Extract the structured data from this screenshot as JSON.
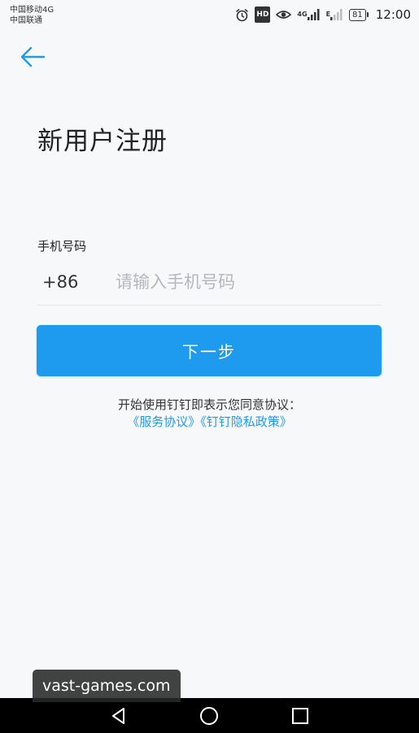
{
  "status_bar": {
    "carrier_1": "中国移动4G",
    "carrier_2": "中国联通",
    "net_tag_1": "4G",
    "net_tag_2": "E",
    "hd_label": "HD",
    "battery_level": "81",
    "time": "12:00"
  },
  "header": {
    "back_icon": "arrow-left-icon"
  },
  "page": {
    "title": "新用户注册"
  },
  "form": {
    "phone_label": "手机号码",
    "country_code": "+86",
    "phone_placeholder": "请输入手机号码",
    "phone_value": ""
  },
  "actions": {
    "next_label": "下一步"
  },
  "agreement": {
    "text": "开始使用钉钉即表示您同意协议：",
    "service_link": "《服务协议》",
    "privacy_link": "《钉钉隐私政策》"
  },
  "watermark": {
    "text": "vast-games.com"
  },
  "colors": {
    "accent": "#1e9bef",
    "background": "#f7f8fa",
    "nav_bar": "#000000"
  }
}
